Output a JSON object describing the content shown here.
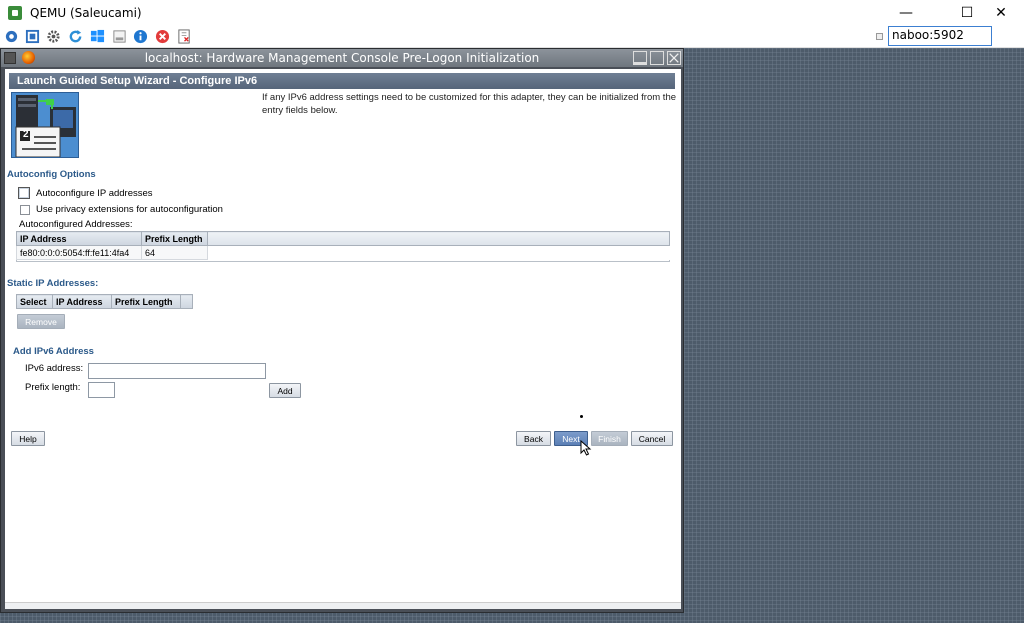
{
  "qemu": {
    "title": "QEMU (Saleucami)",
    "host_field": "naboo:5902",
    "controls": {
      "minimize": "—",
      "maximize": "☐",
      "close": "✕"
    }
  },
  "guest": {
    "window_title": "localhost: Hardware Management Console Pre-Logon Initialization"
  },
  "wizard": {
    "header": "Launch Guided Setup Wizard - Configure IPv6",
    "intro": "If any IPv6 address settings need to be customized for this adapter, they can be initialized from the entry fields below.",
    "graphic_step": "2"
  },
  "autoconfig": {
    "section_title": "Autoconfig Options",
    "checkbox1_label": "Autoconfigure IP addresses",
    "checkbox2_label": "Use privacy extensions for autoconfiguration",
    "addresses_label": "Autoconfigured Addresses:",
    "columns": [
      "IP Address",
      "Prefix Length"
    ],
    "rows": [
      {
        "ip": "fe80:0:0:0:5054:ff:fe11:4fa4",
        "prefix": "64"
      }
    ]
  },
  "static": {
    "section_title": "Static IP Addresses:",
    "columns": [
      "Select",
      "IP Address",
      "Prefix Length"
    ],
    "remove_label": "Remove"
  },
  "add": {
    "section_title": "Add IPv6 Address",
    "ipv6_label": "IPv6 address:",
    "prefix_label": "Prefix length:",
    "ipv6_value": "",
    "prefix_value": "",
    "add_label": "Add"
  },
  "buttons": {
    "help": "Help",
    "back": "Back",
    "next": "Next",
    "finish": "Finish",
    "cancel": "Cancel"
  },
  "colors": {
    "header_bar": "#56657a",
    "section_title": "#2c5a8a",
    "next_button": "#5b7fb5"
  }
}
